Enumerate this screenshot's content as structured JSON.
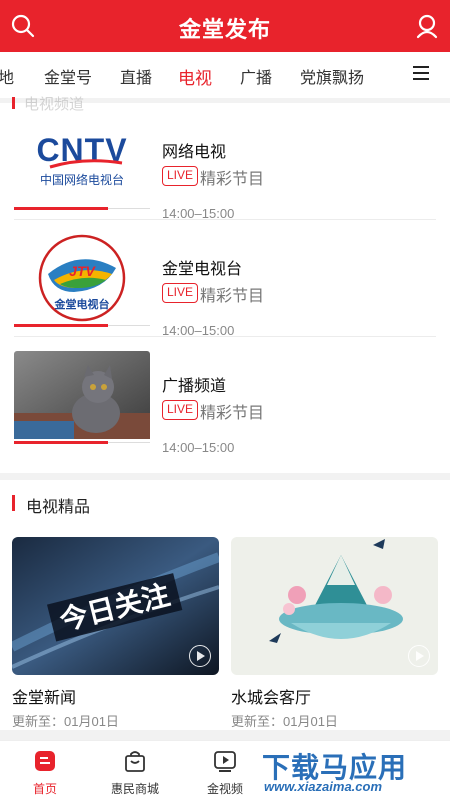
{
  "header": {
    "title": "金堂发布"
  },
  "tabs": [
    "地",
    "金堂号",
    "直播",
    "电视",
    "广播",
    "党旗飘扬"
  ],
  "active_tab": "电视",
  "section1": {
    "title": "电视频道"
  },
  "channels": [
    {
      "name": "网络电视",
      "live": "LIVE",
      "program": "精彩节目",
      "time": "14:00–15:00",
      "logo": "CNTV 中国网络电视台"
    },
    {
      "name": "金堂电视台",
      "live": "LIVE",
      "program": "精彩节目",
      "time": "14:00–15:00",
      "logo": "JTV 金堂电视台"
    },
    {
      "name": "广播频道",
      "live": "LIVE",
      "program": "精彩节目",
      "time": "14:00–15:00",
      "logo": "kitten-photo"
    }
  ],
  "section2": {
    "title": "电视精品"
  },
  "videos": [
    {
      "name": "金堂新闻",
      "update": "更新至：01月01日",
      "image_text": "今日关注"
    },
    {
      "name": "水城会客厅",
      "update": "更新至：01月01日",
      "image_text": ""
    }
  ],
  "bottom_nav": [
    {
      "label": "首页",
      "icon": "home-icon"
    },
    {
      "label": "惠民商城",
      "icon": "shopping-bag-icon"
    },
    {
      "label": "金视频",
      "icon": "play-video-icon"
    }
  ],
  "watermark": {
    "line1": "下载马应用",
    "line2": "www.xiazaima.com"
  },
  "colors": {
    "brand_red": "#e8232c"
  }
}
